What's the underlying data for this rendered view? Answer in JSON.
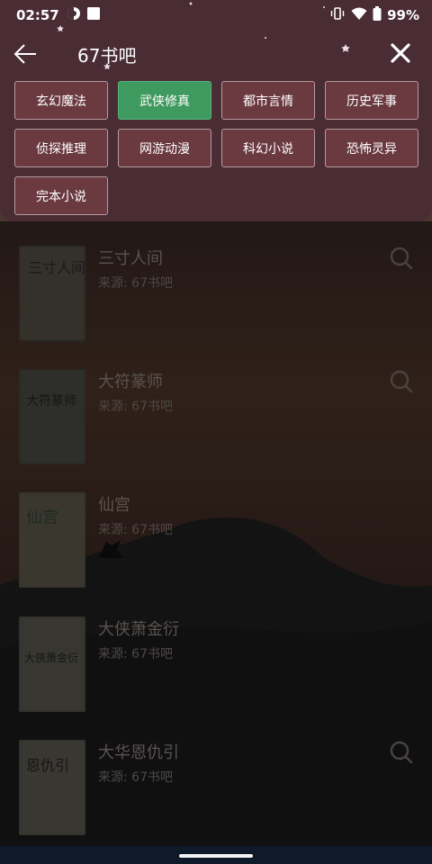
{
  "status_bar": {
    "time": "02:57",
    "battery": "99%",
    "icons": [
      "data-saver-icon",
      "notification-square-icon",
      "vibrate-icon",
      "wifi-icon",
      "battery-icon"
    ]
  },
  "toolbar": {
    "title": "67书吧",
    "back_icon": "arrow-left-icon",
    "close_icon": "close-icon"
  },
  "categories": {
    "selected_index": 1,
    "items": [
      "玄幻魔法",
      "武侠修真",
      "都市言情",
      "历史军事",
      "侦探推理",
      "网游动漫",
      "科幻小说",
      "恐怖灵异",
      "完本小说"
    ]
  },
  "books": [
    {
      "title": "三寸人间",
      "source": "来源: 67书吧",
      "cover_text": "三寸人间"
    },
    {
      "title": "大符篆师",
      "source": "来源: 67书吧",
      "cover_text": "大符篆师"
    },
    {
      "title": "仙宫",
      "source": "来源: 67书吧",
      "cover_text": "仙宫"
    },
    {
      "title": "大侠萧金衍",
      "source": "来源: 67书吧",
      "cover_text": "大侠萧金衍"
    },
    {
      "title": "大华恩仇引",
      "source": "来源: 67书吧",
      "cover_text": "恩仇引"
    }
  ],
  "colors": {
    "panel": "#4a2c35",
    "chip": "#6b3a40",
    "chip_selected": "#3f9a5f"
  }
}
